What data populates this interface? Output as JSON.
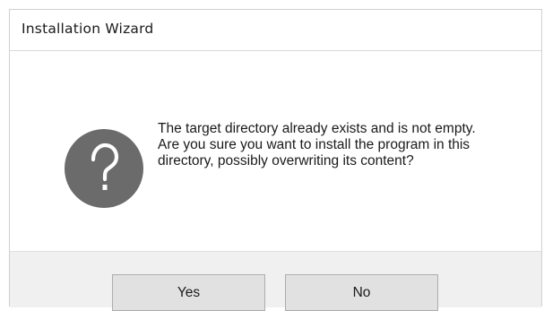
{
  "dialog": {
    "title": "Installation Wizard",
    "icon": "question-icon",
    "message": "The target directory already exists and is not empty. Are you sure you want to install the program in this directory, possibly overwriting its content?"
  },
  "buttons": {
    "yes_label": "Yes",
    "no_label": "No"
  },
  "colors": {
    "icon_fill": "#6b6b6b",
    "button_bar": "#f0f0f0",
    "button_face": "#e1e1e1",
    "button_border": "#adadad"
  }
}
